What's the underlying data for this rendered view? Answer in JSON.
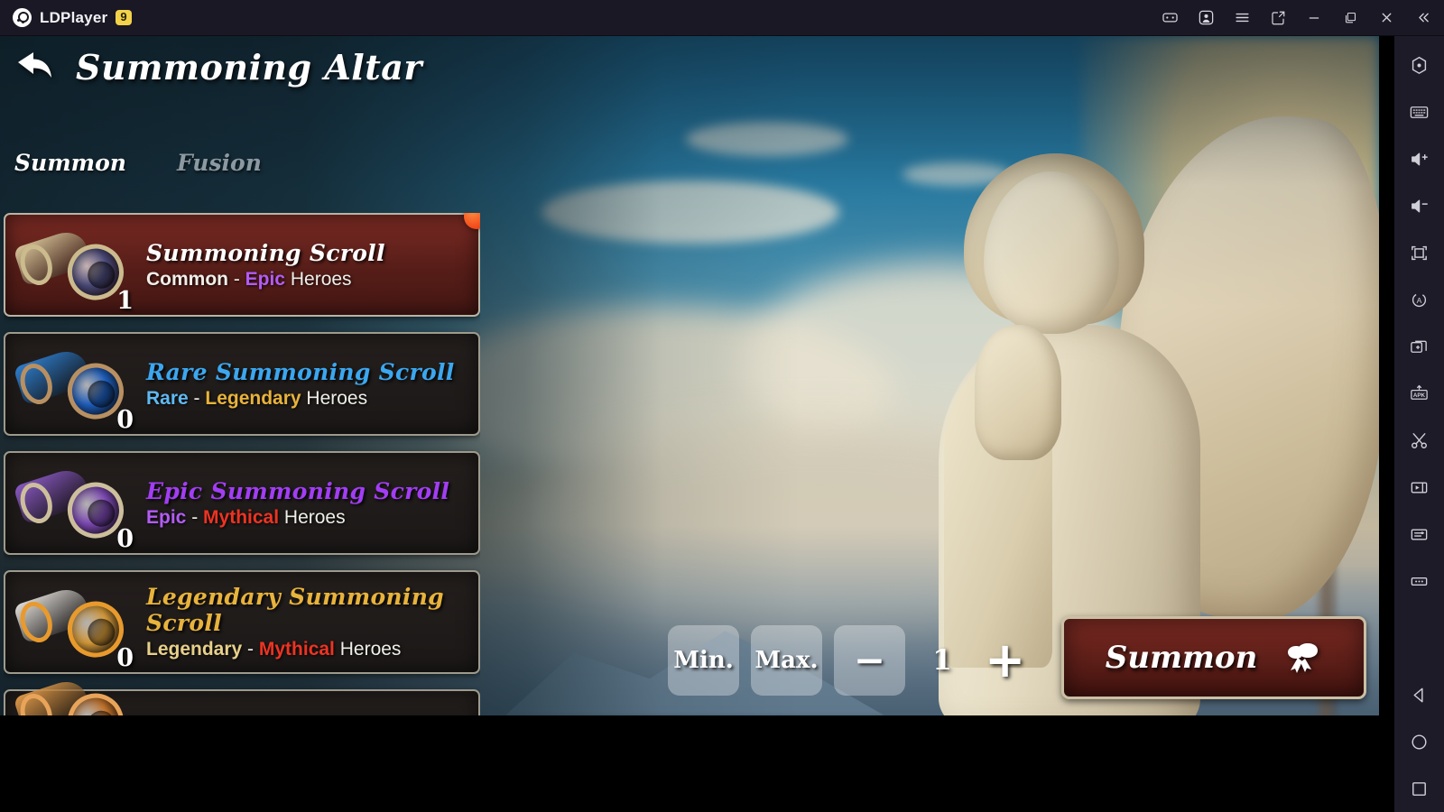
{
  "window": {
    "brand_name": "LDPlayer",
    "version_badge": "9",
    "title_buttons": [
      {
        "name": "gamepad-icon",
        "label": "Gamepad"
      },
      {
        "name": "account-icon",
        "label": "Account"
      },
      {
        "name": "menu-icon",
        "label": "Menu"
      },
      {
        "name": "share-icon",
        "label": "Share"
      },
      {
        "name": "minimize-icon",
        "label": "Minimize"
      },
      {
        "name": "maximize-icon",
        "label": "Maximize"
      },
      {
        "name": "close-icon",
        "label": "Close"
      },
      {
        "name": "collapse-sidebar-icon",
        "label": "Collapse"
      }
    ],
    "toolbar_items": [
      {
        "name": "settings-icon",
        "label": "Settings"
      },
      {
        "name": "keyboard-icon",
        "label": "Keyboard mapping"
      },
      {
        "name": "volume-up-icon",
        "label": "Volume up"
      },
      {
        "name": "volume-down-icon",
        "label": "Volume down"
      },
      {
        "name": "fullscreen-icon",
        "label": "Full screen"
      },
      {
        "name": "rotate-icon",
        "label": "Rotate screen"
      },
      {
        "name": "multi-instance-icon",
        "label": "Multi-instance"
      },
      {
        "name": "install-apk-icon",
        "label": "Install APK"
      },
      {
        "name": "scissors-icon",
        "label": "Screenshot"
      },
      {
        "name": "video-record-icon",
        "label": "Record"
      },
      {
        "name": "operation-recorder-icon",
        "label": "Operation recorder"
      },
      {
        "name": "more-icon",
        "label": "More"
      },
      {
        "name": "android-back-icon",
        "label": "Back"
      },
      {
        "name": "android-home-icon",
        "label": "Home"
      },
      {
        "name": "android-recents-icon",
        "label": "Recents"
      }
    ]
  },
  "game": {
    "page_title": "Summoning Altar",
    "back_label": "Back",
    "tabs": [
      {
        "label": "Summon",
        "active": true
      },
      {
        "label": "Fusion",
        "active": false
      }
    ],
    "scrolls": [
      {
        "name": "Summoning Scroll",
        "name_color": "#ffffff",
        "qty": "1",
        "range_from": "Common",
        "range_from_color": "#f0eee9",
        "range_to": "Epic",
        "range_to_color": "#b35cf5",
        "heroes_word": "Heroes",
        "selected": true,
        "has_notify_dot": true,
        "art": {
          "tube": "#d8c79a",
          "disc": "#4a4a7a",
          "ring": "#cbbb8d"
        }
      },
      {
        "name": "Rare Summoning Scroll",
        "name_color": "#3ba7f0",
        "qty": "0",
        "range_from": "Rare",
        "range_from_color": "#5fb9f2",
        "range_to": "Legendary",
        "range_to_color": "#e8b33c",
        "heroes_word": "Heroes",
        "selected": false,
        "has_notify_dot": false,
        "art": {
          "tube": "#2f7fd0",
          "disc": "#1e5fbf",
          "ring": "#b99062"
        }
      },
      {
        "name": "Epic Summoning Scroll",
        "name_color": "#a23df5",
        "qty": "0",
        "range_from": "Epic",
        "range_from_color": "#b35cf5",
        "range_to": "Mythical",
        "range_to_color": "#ee3322",
        "heroes_word": "Heroes",
        "selected": false,
        "has_notify_dot": false,
        "art": {
          "tube": "#8a5ac4",
          "disc": "#7f4ab7",
          "ring": "#cdbf9c"
        }
      },
      {
        "name": "Legendary Summoning Scroll",
        "name_color": "#e8b33c",
        "qty": "0",
        "range_from": "Legendary",
        "range_from_color": "#e8d08a",
        "range_to": "Mythical",
        "range_to_color": "#ee3322",
        "heroes_word": "Heroes",
        "selected": false,
        "has_notify_dot": false,
        "art": {
          "tube": "#e4e1dc",
          "disc": "#d79b3a",
          "ring": "#e89a2d"
        }
      },
      {
        "name": "",
        "name_color": "#ffffff",
        "qty": "",
        "range_from": "",
        "range_from_color": "#ffffff",
        "range_to": "",
        "range_to_color": "#ffffff",
        "heroes_word": "",
        "selected": false,
        "has_notify_dot": false,
        "clipped": true,
        "art": {
          "tube": "#e09a4a",
          "disc": "#c8762c",
          "ring": "#e8a45a"
        }
      }
    ],
    "controls": {
      "min_label": "Min.",
      "max_label": "Max.",
      "minus_label": "−",
      "plus_label": "+",
      "quantity": "1",
      "summon_label": "Summon",
      "summon_icon": "scroll-icon"
    }
  }
}
